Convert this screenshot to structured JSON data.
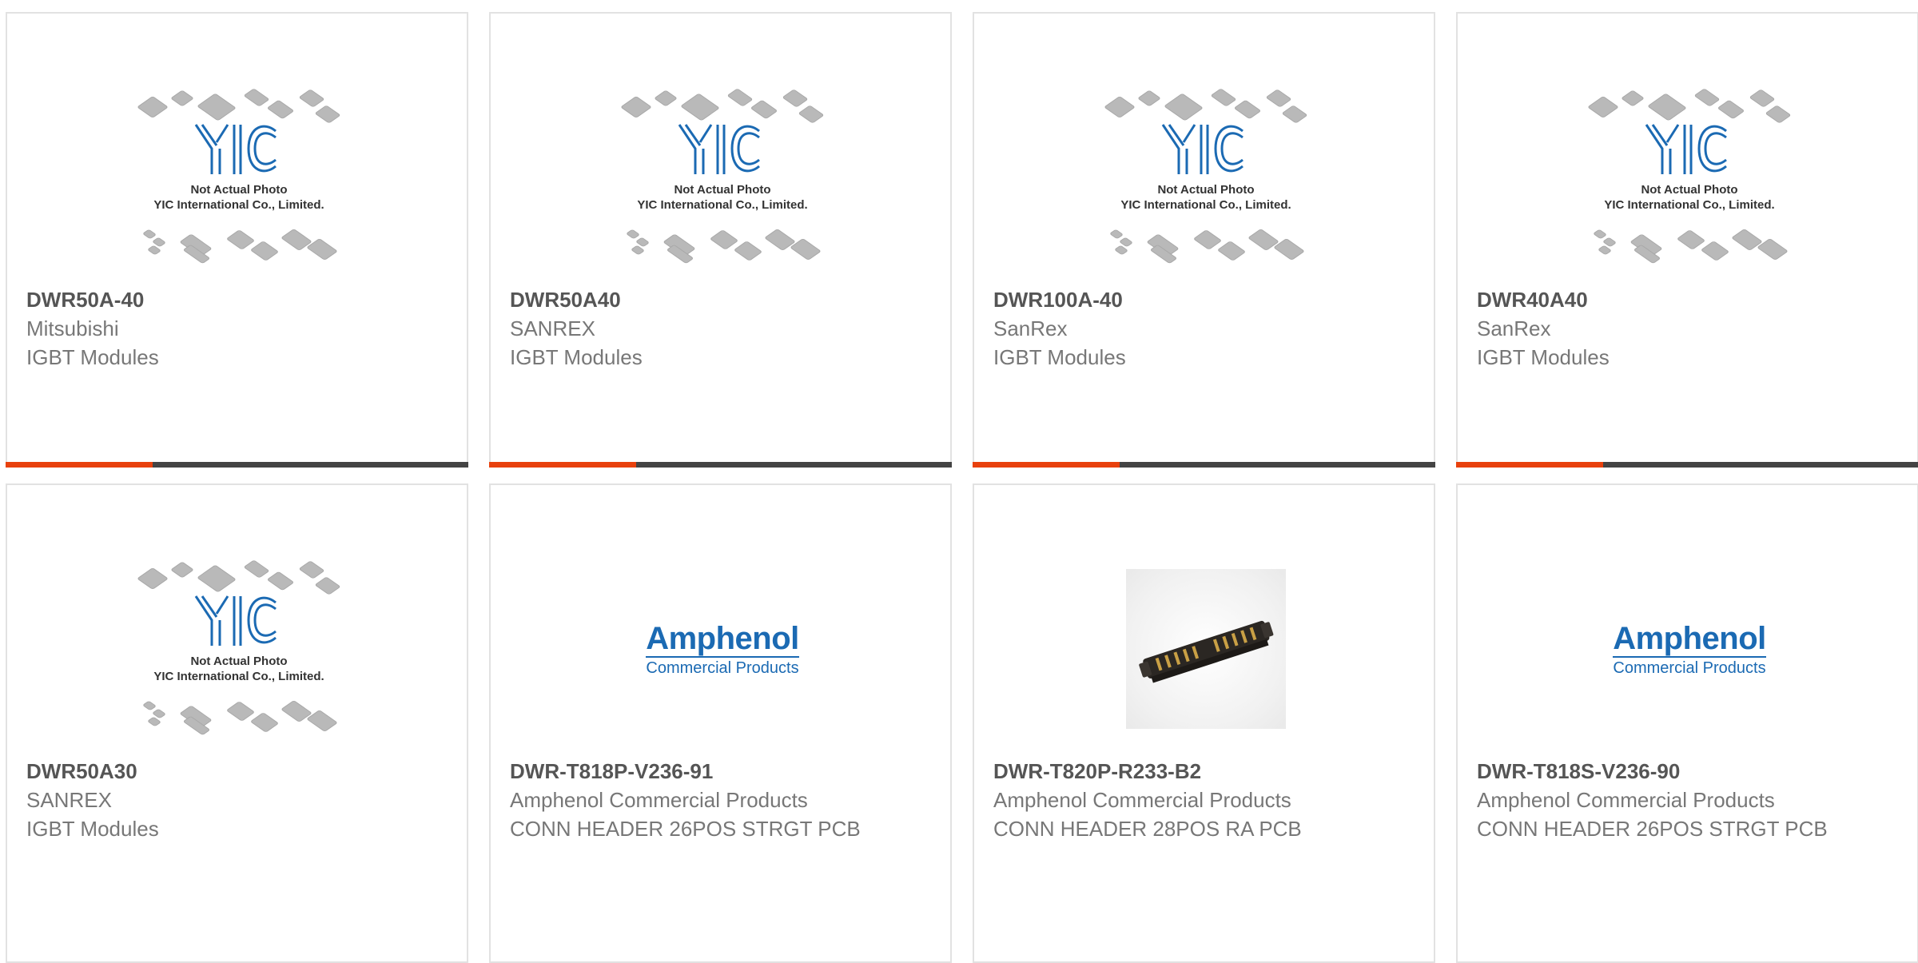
{
  "theme": {
    "accent_color": "#e8410d",
    "bar_color": "#444444",
    "border_color": "#e2e2e2"
  },
  "placeholder_image": {
    "caption_line1": "Not Actual Photo",
    "caption_line2": "YIC International Co., Limited.",
    "logo_text": "YIC"
  },
  "products": [
    {
      "part_number": "DWR50A-40",
      "manufacturer": "Mitsubishi",
      "category": "IGBT Modules",
      "image": "yic-placeholder",
      "category_bar": true
    },
    {
      "part_number": "DWR50A40",
      "manufacturer": "SANREX",
      "category": "IGBT Modules",
      "image": "yic-placeholder",
      "category_bar": true
    },
    {
      "part_number": "DWR100A-40",
      "manufacturer": "SanRex",
      "category": "IGBT Modules",
      "image": "yic-placeholder",
      "category_bar": true
    },
    {
      "part_number": "DWR40A40",
      "manufacturer": "SanRex",
      "category": "IGBT Modules",
      "image": "yic-placeholder",
      "category_bar": true
    },
    {
      "part_number": "DWR50A30",
      "manufacturer": "SANREX",
      "category": "IGBT Modules",
      "image": "yic-placeholder",
      "category_bar": false
    },
    {
      "part_number": "DWR-T818P-V236-91",
      "manufacturer": "Amphenol Commercial Products",
      "category": "CONN HEADER 26POS STRGT PCB",
      "image": "amphenol-logo",
      "category_bar": false
    },
    {
      "part_number": "DWR-T820P-R233-B2",
      "manufacturer": "Amphenol Commercial Products",
      "category": "CONN HEADER 28POS RA PCB",
      "image": "connector-photo",
      "category_bar": false
    },
    {
      "part_number": "DWR-T818S-V236-90",
      "manufacturer": "Amphenol Commercial Products",
      "category": "CONN HEADER 26POS STRGT PCB",
      "image": "amphenol-logo",
      "category_bar": false
    }
  ],
  "amphenol_logo": {
    "name": "Amphenol",
    "subtitle": "Commercial Products"
  }
}
